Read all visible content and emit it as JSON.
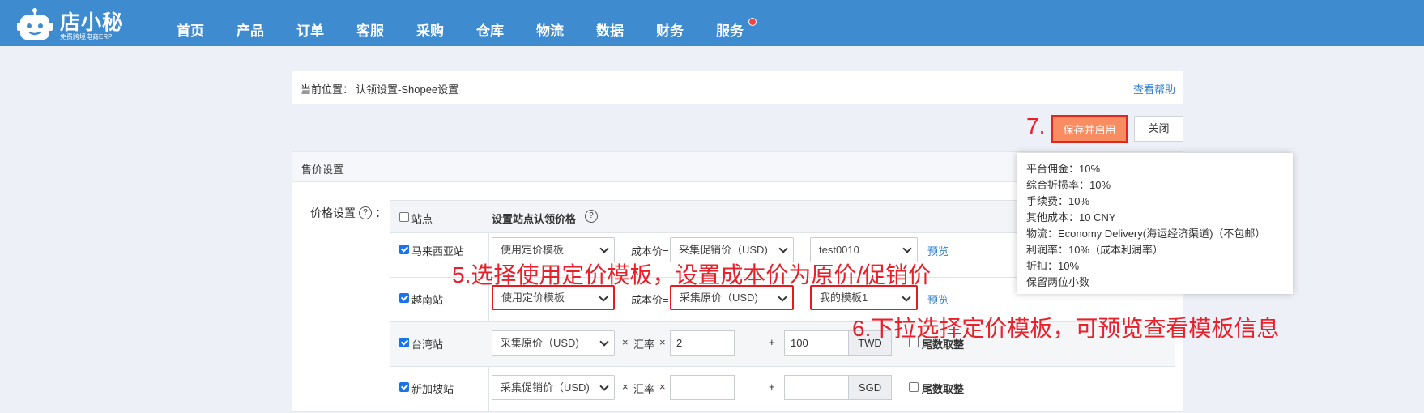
{
  "header": {
    "brand": "店小秘",
    "tagline": "免费跨境电商ERP",
    "nav": [
      "首页",
      "产品",
      "订单",
      "客服",
      "采购",
      "仓库",
      "物流",
      "数据",
      "财务",
      "服务"
    ]
  },
  "breadcrumb": {
    "label": "当前位置：",
    "path": "认领设置-Shopee设置",
    "help": "查看帮助"
  },
  "actions": {
    "step_marker": "7.",
    "save_enable": "保存并启用",
    "close": "关闭"
  },
  "panel": {
    "title": "售价设置",
    "price_label": "价格设置",
    "colon": "："
  },
  "table": {
    "header_site": "站点",
    "header_price": "设置站点认领价格",
    "rows": [
      {
        "site": "马来西亚站",
        "mode": "使用定价模板",
        "cost_label": "成本价=",
        "cost": "采集促销价（USD)",
        "template": "test0010",
        "preview": "预览"
      },
      {
        "site": "越南站",
        "mode": "使用定价模板",
        "cost_label": "成本价=",
        "cost": "采集原价（USD)",
        "template": "我的模板1",
        "preview": "预览"
      },
      {
        "site": "台湾站",
        "source": "采集原价（USD)",
        "times": "×",
        "rate_label": "汇率",
        "rate": "2",
        "plus": "+",
        "add": "100",
        "currency": "TWD",
        "round": "尾数取整"
      },
      {
        "site": "新加坡站",
        "source": "采集促销价（USD)",
        "times": "×",
        "rate_label": "汇率",
        "rate": "",
        "plus": "+",
        "add": "",
        "currency": "SGD",
        "round": "尾数取整"
      }
    ]
  },
  "annotations": {
    "step5": "5.选择使用定价模板，设置成本价为原价/促销价",
    "step6": "6.下拉选择定价模板，可预览查看模板信息"
  },
  "tooltip": [
    "平台佣金：10%",
    "综合折损率：10%",
    "手续费：10%",
    "其他成本：10 CNY",
    "物流：Economy Delivery(海运经济渠道)（不包邮）",
    "利润率：10%（成本利润率）",
    "折扣：10%",
    "保留两位小数"
  ],
  "colors": {
    "header_bg": "#3f8bcf",
    "page_bg": "#edf0f6",
    "save_button": "#fa8c61",
    "annotation_red": "#e6212a",
    "link_blue": "#2f7fd0",
    "checkbox_blue": "#1a73e8"
  }
}
